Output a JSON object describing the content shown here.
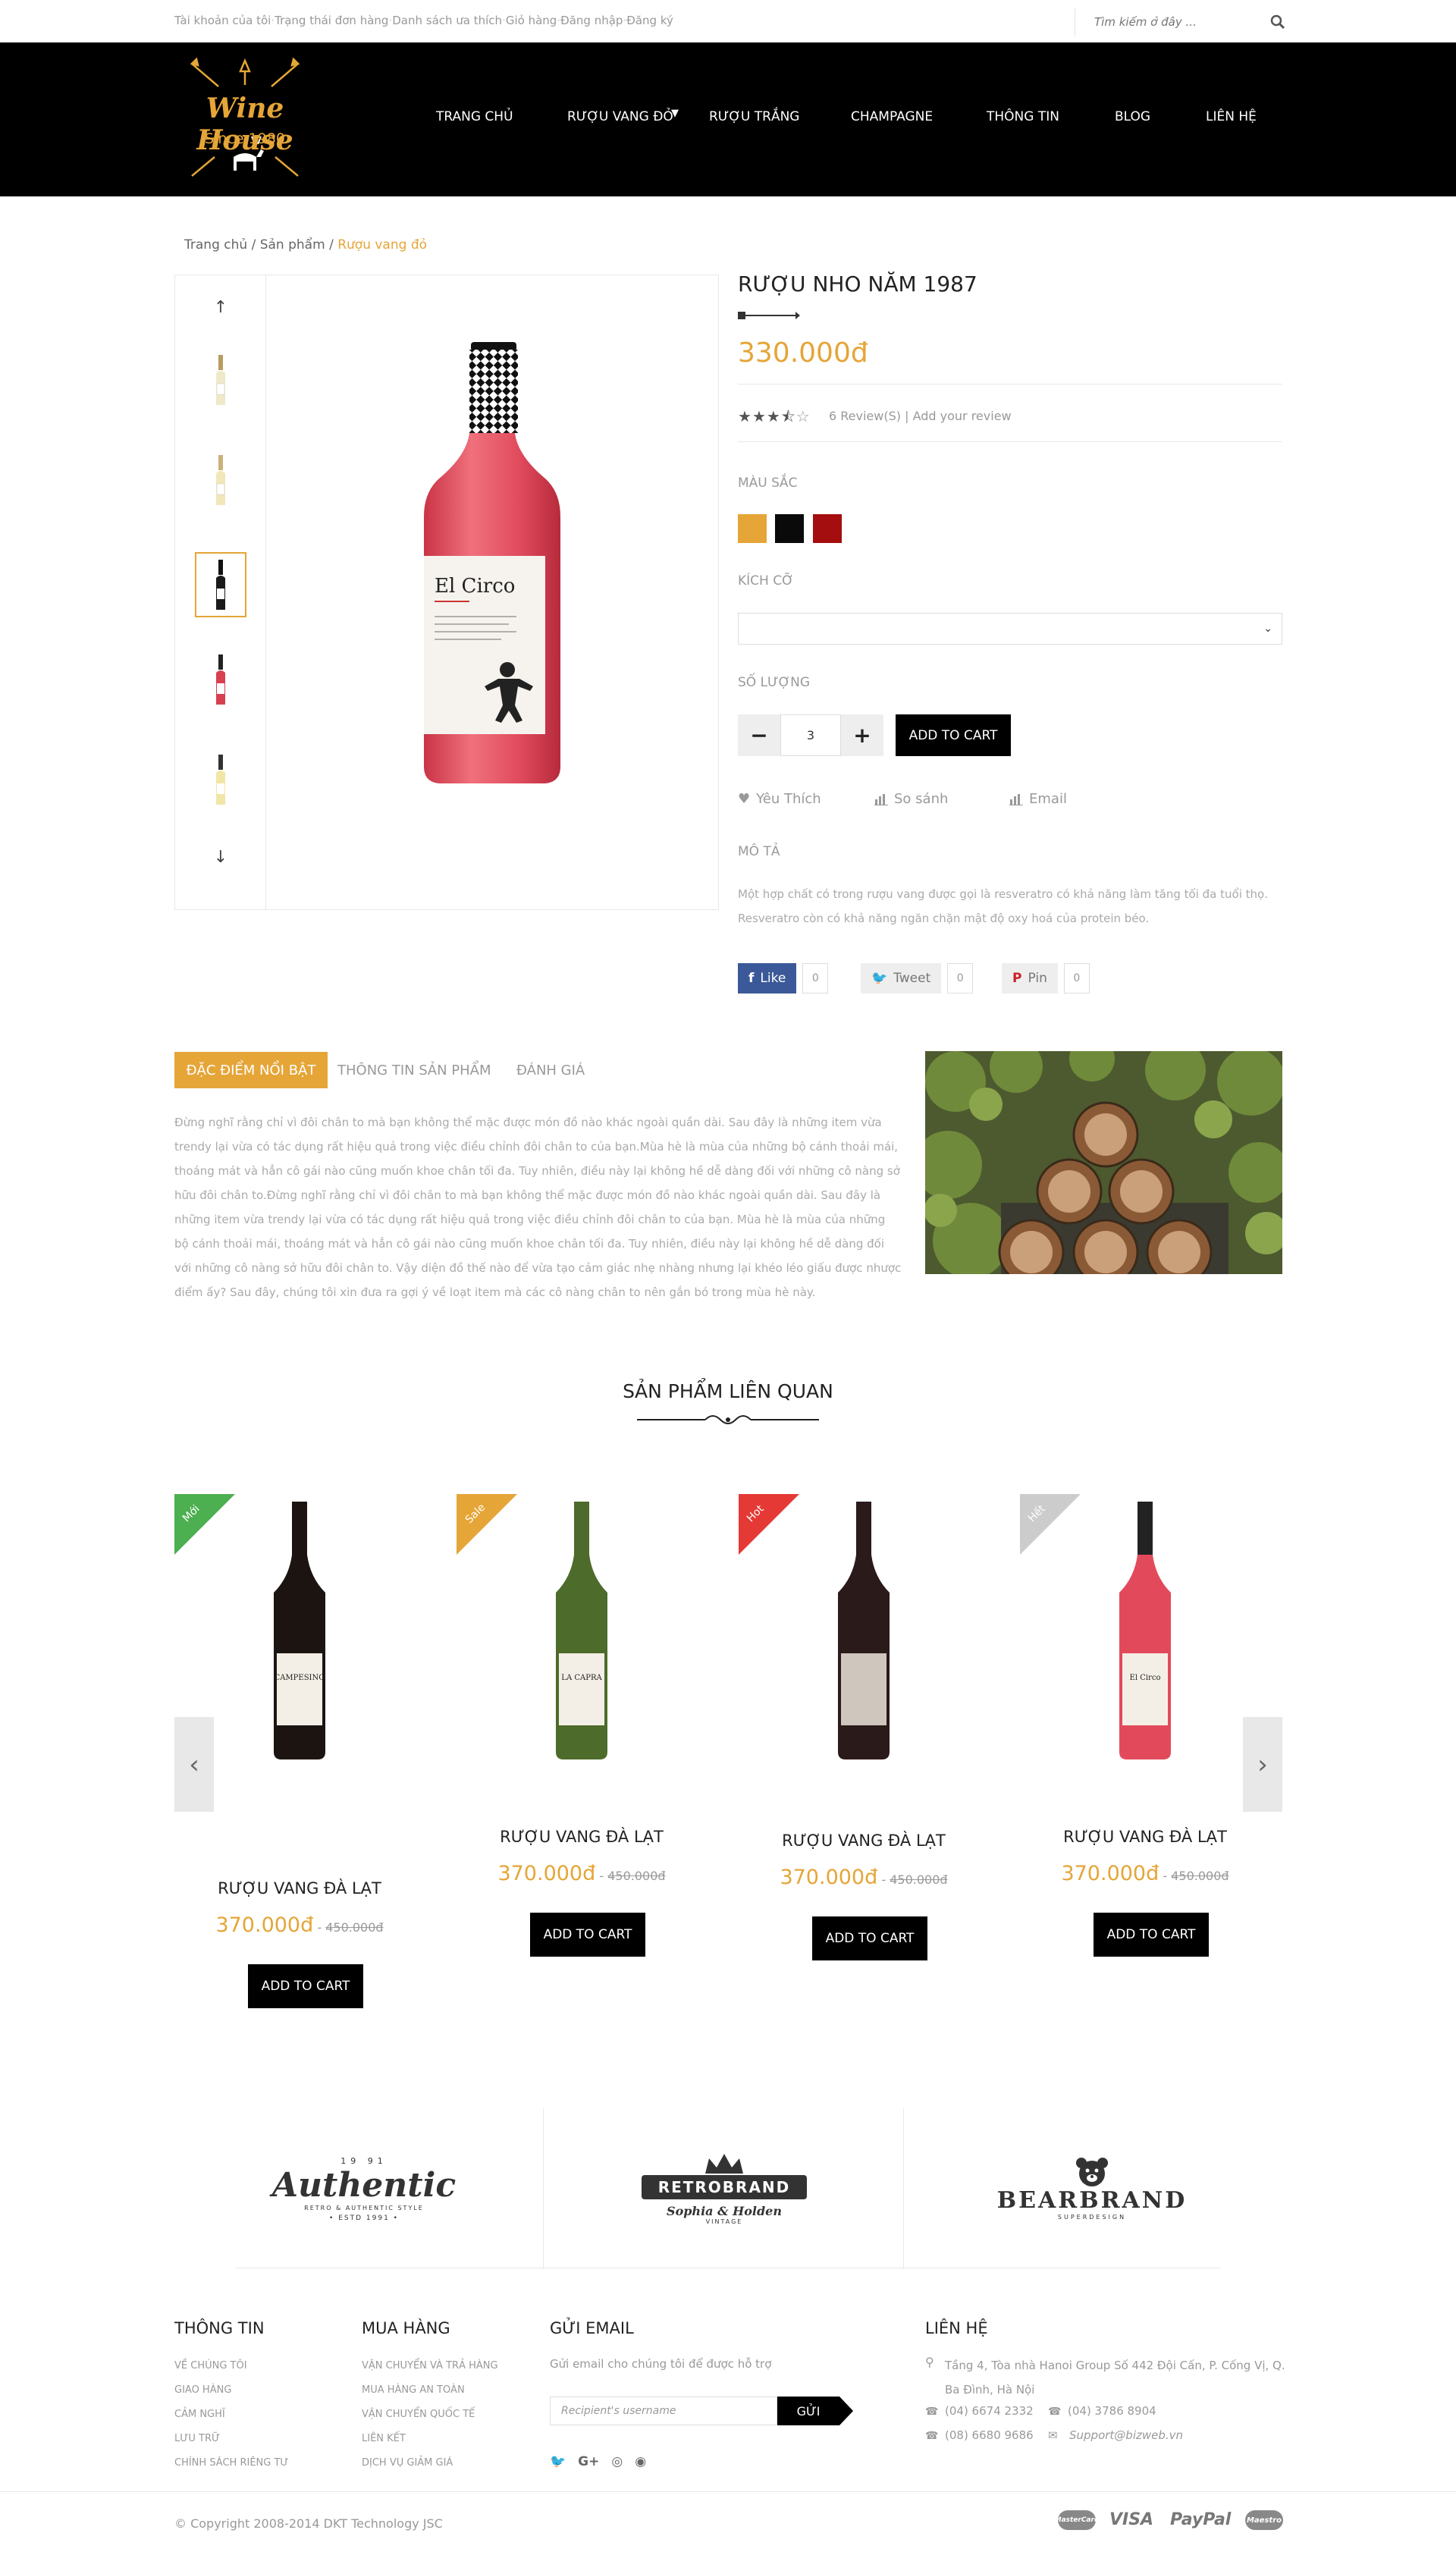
{
  "topbar": {
    "links": [
      "Tài khoản của tôi",
      "Trạng thái đơn hàng",
      "Danh sách ưa thích",
      "Giỏ hàng",
      "Đăng nhập",
      "Đăng ký"
    ],
    "search_placeholder": "Tìm kiếm ở đây ..."
  },
  "logo": {
    "title": "Wine House",
    "since": "Since 1980"
  },
  "nav": [
    "TRANG CHỦ",
    "RƯỢU VANG ĐỎ",
    "RƯỢU TRẮNG",
    "CHAMPAGNE",
    "THÔNG TIN",
    "BLOG",
    "LIÊN HỆ"
  ],
  "breadcrumb": {
    "home": "Trang chủ",
    "sep": "/",
    "products": "Sản phẩm",
    "current": "Rượu vang đỏ"
  },
  "product": {
    "title": "RƯỢU NHO NĂM 1987",
    "price": "330.000đ",
    "rating": 3.5,
    "reviews": "6 Review(S)",
    "review_sep": "|",
    "add_review": "Add your review",
    "color_label": "MÀU SẮC",
    "colors": [
      "#e5a537",
      "#0a0a0a",
      "#a50e0e"
    ],
    "size_label": "KÍCH CỠ",
    "qty_label": "SỐ LƯỢNG",
    "qty_minus": "−",
    "qty_value": "3",
    "qty_plus": "+",
    "add_to_cart": "ADD TO CART",
    "wishlist": "Yêu Thích",
    "compare": "So sánh",
    "email": "Email",
    "desc_title": "MÔ TẢ",
    "description": "Một hợp chất có trong rượu vang được gọi là resveratro có khả năng làm tăng tối đa tuổi thọ. Resveratro còn có khả năng ngăn chặn mật độ oxy hoá của protein béo.",
    "bottle_label": "El Circo",
    "social": [
      {
        "label": "Like",
        "count": "0",
        "bg": "#3b5998",
        "fg": "#ffffff"
      },
      {
        "label": "Tweet",
        "count": "0",
        "bg": "#eeeeee",
        "fg": "#777777"
      },
      {
        "label": "Pin",
        "count": "0",
        "bg": "#eeeeee",
        "fg": "#777777"
      }
    ]
  },
  "tabs": {
    "active": "ĐẶC ĐIỂM NỔI BẬT",
    "info": "THÔNG TIN SẢN PHẨM",
    "reviews": "ĐÁNH GIÁ",
    "content": "Đừng nghĩ rằng chỉ vì đôi chân to mà bạn không thể mặc được món đồ nào khác ngoài quần dài. Sau đây là những item vừa trendy lại vừa có tác dụng rất hiệu quả trong việc điều chỉnh đôi chân to của bạn.Mùa hè là mùa của những bộ cánh thoải mái, thoáng mát và hẳn cô gái nào cũng muốn khoe chân tối đa. Tuy nhiên, điều này lại không hề dễ dàng đối với những cô nàng sở hữu đôi chân to.Đừng nghĩ rằng chỉ vì đôi chân to mà bạn không thể mặc được món đồ nào khác ngoài quần dài. Sau đây là những item vừa trendy lại vừa có tác dụng rất hiệu quả trong việc điều chỉnh đôi chân to của bạn. Mùa hè là mùa của những bộ cánh thoải mái, thoáng mát và hẳn cô gái nào cũng muốn khoe chân tối đa. Tuy nhiên, điều này lại không hề dễ dàng đối với những cô nàng sở hữu đôi chân to. Vậy diện đồ thế nào để vừa tạo cảm giác nhẹ nhàng nhưng lại khéo léo giấu được nhược điểm ấy? Sau đây, chúng tôi xin đưa ra gợi ý về loạt item mà các cô nàng chân to nên gắn bó trong mùa hè này."
  },
  "related": {
    "title": "SẢN PHẨM LIÊN QUAN",
    "items": [
      {
        "badge": "Mới",
        "badge_color": "#4caf50",
        "name": "RƯỢU VANG ĐÀ LẠT",
        "price": "370.000đ",
        "old": "450.000đ",
        "btn": "ADD TO CART",
        "bottle_color": "#1b1410",
        "label": "CAMPESINO"
      },
      {
        "badge": "Sale",
        "badge_color": "#e5a537",
        "name": "RƯỢU VANG ĐÀ LẠT",
        "price": "370.000đ",
        "old": "450.000đ",
        "btn": "ADD TO CART",
        "bottle_color": "#4d6b2a",
        "label": "LA CAPRA"
      },
      {
        "badge": "Hot",
        "badge_color": "#e53935",
        "name": "RƯỢU VANG ĐÀ LẠT",
        "price": "370.000đ",
        "old": "450.000đ",
        "btn": "ADD TO CART",
        "bottle_color": "#2b1a1a",
        "label": ""
      },
      {
        "badge": "Hết",
        "badge_color": "#cccccc",
        "name": "RƯỢU VANG ĐÀ LẠT",
        "price": "370.000đ",
        "old": "450.000đ",
        "btn": "ADD TO CART",
        "bottle_color": "#e24a5c",
        "label": "El Circo"
      }
    ]
  },
  "brands": [
    {
      "name": "Authentic",
      "top": "19 91",
      "sub": "RETRO & AUTHENTIC STYLE",
      "est": "• ESTD 1991 •"
    },
    {
      "name": "RETROBRAND",
      "sub": "Sophia & Holden",
      "est": "VINTAGE"
    },
    {
      "name": "BEARBRAND",
      "sub": "SUPERDESIGN"
    }
  ],
  "footer": {
    "info_title": "THÔNG TIN",
    "info_links": [
      "VỀ CHÚNG TÔI",
      "GIAO HÀNG",
      "CẢM NGHĨ",
      "LƯU TRỮ",
      "CHÍNH SÁCH RIÊNG TƯ"
    ],
    "buy_title": "MUA HÀNG",
    "buy_links": [
      "VẬN CHUYỂN VÀ TRẢ HÀNG",
      "MUA HÀNG AN TOÀN",
      "VẬN CHUYỂN QUỐC TẾ",
      "LIÊN KẾT",
      "DỊCH VỤ GIẢM GIÁ"
    ],
    "email_title": "GỬI EMAIL",
    "email_text": "Gửi email cho chúng tôi để được hỗ trợ",
    "email_placeholder": "Recipient's username",
    "email_btn": "GỬI",
    "contact_title": "LIÊN HỆ",
    "address": "Tầng 4, Tòa nhà Hanoi Group Số 442 Đội Cấn, P. Cống Vị, Q. Ba Đình, Hà Nội",
    "phone1": "(04) 6674 2332",
    "phone2": "(04) 3786 8904",
    "phone3": "(08) 6680 9686",
    "support": "Support@bizweb.vn",
    "copyright": "© Copyright 2008-2014 DKT Technology JSC",
    "payments": [
      "MasterCard",
      "VISA",
      "PayPal",
      "Maestro"
    ]
  }
}
